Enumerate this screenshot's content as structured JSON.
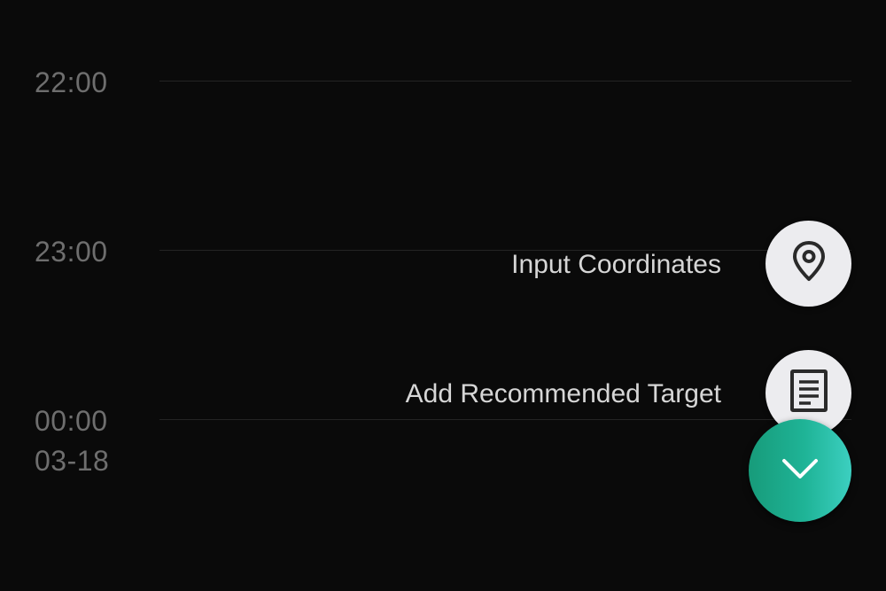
{
  "timeline": {
    "hours": [
      {
        "time": "22:00",
        "date": ""
      },
      {
        "time": "23:00",
        "date": ""
      },
      {
        "time": "00:00",
        "date": "03-18"
      }
    ]
  },
  "fab_menu": {
    "items": [
      {
        "label": "Input Coordinates",
        "icon": "location-pin-icon"
      },
      {
        "label": "Add Recommended Target",
        "icon": "document-list-icon"
      }
    ],
    "toggle_icon": "chevron-down-icon"
  },
  "colors": {
    "background": "#0a0a0a",
    "time_text": "#6e6e6e",
    "grid_line": "#242424",
    "menu_label": "#d6d6d6",
    "mini_fab_bg": "#ececef",
    "accent_start": "#179b7a",
    "accent_end": "#3ccfc0"
  }
}
